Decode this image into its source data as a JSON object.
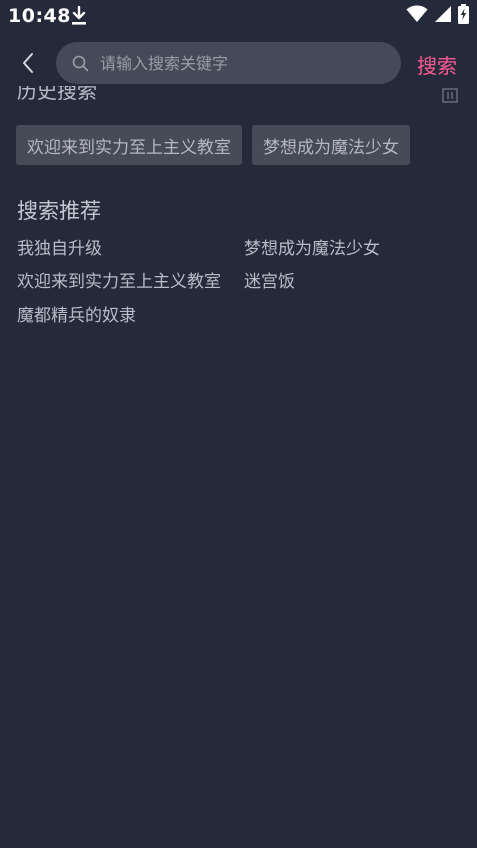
{
  "status_bar": {
    "time": "10:48",
    "icons": [
      "download-icon",
      "wifi-icon",
      "signal-icon",
      "battery-charging-icon"
    ]
  },
  "header": {
    "back_icon": "chevron-left-icon",
    "search": {
      "icon": "search-icon",
      "value": "",
      "placeholder": "请输入搜索关键字"
    },
    "submit_label": "搜索"
  },
  "history": {
    "title": "历史搜索",
    "clear_icon": "trash-icon",
    "items": [
      {
        "label": "欢迎来到实力至上主义教室"
      },
      {
        "label": "梦想成为魔法少女"
      }
    ]
  },
  "recommend": {
    "title": "搜索推荐",
    "items": [
      {
        "label": "我独自升级"
      },
      {
        "label": "梦想成为魔法少女"
      },
      {
        "label": "欢迎来到实力至上主义教室"
      },
      {
        "label": "迷宫饭"
      },
      {
        "label": "魔都精兵的奴隶"
      }
    ]
  },
  "colors": {
    "background": "#252a3a",
    "search_box": "#464a58",
    "chip": "#474b58",
    "accent": "#ff5a93",
    "text": "#b9bcc7"
  }
}
